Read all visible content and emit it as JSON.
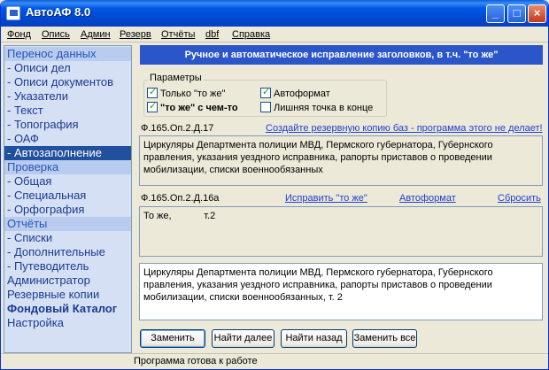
{
  "window": {
    "title": "АвтоАФ 8.0"
  },
  "titlebar_buttons": {
    "minimize": "_",
    "maximize": "□",
    "close": "×"
  },
  "menu": [
    "Фонд",
    "Опись",
    "Админ",
    "Резерв",
    "Отчёты",
    "dbf",
    "Справка"
  ],
  "sidebar": {
    "items": [
      {
        "label": "Перенос данных",
        "kind": "header"
      },
      {
        "label": "- Описи дел",
        "kind": "item"
      },
      {
        "label": "- Описи документов",
        "kind": "item"
      },
      {
        "label": "- Указатели",
        "kind": "item"
      },
      {
        "label": "- Текст",
        "kind": "item"
      },
      {
        "label": "- Топография",
        "kind": "item"
      },
      {
        "label": "- ОАФ",
        "kind": "item"
      },
      {
        "label": "- Автозаполнение",
        "kind": "selected"
      },
      {
        "label": "Проверка",
        "kind": "header"
      },
      {
        "label": "- Общая",
        "kind": "item"
      },
      {
        "label": "- Специальная",
        "kind": "item"
      },
      {
        "label": "- Орфография",
        "kind": "item"
      },
      {
        "label": "Отчёты",
        "kind": "header"
      },
      {
        "label": "- Списки",
        "kind": "item"
      },
      {
        "label": "- Дополнительные",
        "kind": "item"
      },
      {
        "label": "- Путеводитель",
        "kind": "item"
      },
      {
        "label": "Администратор",
        "kind": "item"
      },
      {
        "label": "Резервные копии",
        "kind": "item"
      },
      {
        "label": "Фондовый Каталог",
        "kind": "bold"
      },
      {
        "label": "Настройка",
        "kind": "item"
      }
    ]
  },
  "panel": {
    "header": "Ручное и автоматическое исправление заголовков, в т.ч. \"то же\"",
    "params_title": "Параметры",
    "options": [
      {
        "label": "Только \"то же\"",
        "checked": true
      },
      {
        "label": "Автоформат",
        "checked": true
      },
      {
        "label": "\"то же\" с чем-то",
        "checked": true
      },
      {
        "label": "Лишняя точка в конце",
        "checked": false
      }
    ],
    "ref1": "Ф.165.Оп.2.Д.17",
    "backup_link": "Создайте резервную копию баз - программа этого не делает!",
    "text1": "Циркуляры Департмента полиции МВД, Пермского губернатора, Губернского правления, указания уездного исправника, рапорты приставов о проведении мобилизации, списки военнообязанных",
    "ref2": "Ф.165.Оп.2.Д.16а",
    "link_fix": "Исправить \"то же\"",
    "link_autoformat": "Автоформат",
    "link_reset": "Сбросить",
    "text2": "То же,            т.2",
    "text3": "Циркуляры Департмента полиции МВД, Пермского губернатора, Губернского правления, указания уездного исправника, рапорты приставов о проведении мобилизации, списки военнообязанных, т. 2"
  },
  "buttons": {
    "replace": "Заменить",
    "find_next": "Найти далее",
    "find_prev": "Найти назад",
    "replace_all": "Заменить все"
  },
  "status": "Программа готова к работе"
}
